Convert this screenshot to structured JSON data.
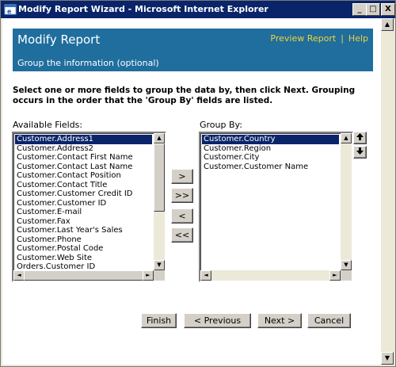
{
  "window": {
    "title": "Modify Report Wizard - Microsoft Internet Explorer",
    "minimize": "_",
    "maximize": "□",
    "close": "X"
  },
  "banner": {
    "title": "Modify Report",
    "subtitle": "Group the information (optional)",
    "preview_link": "Preview Report",
    "separator": "|",
    "help_link": "Help"
  },
  "instructions": "Select one or more fields to group the data by, then click Next. Grouping occurs in the order that the 'Group By' fields are listed.",
  "available": {
    "label": "Available Fields:",
    "items": [
      "Customer.Address1",
      "Customer.Address2",
      "Customer.Contact First Name",
      "Customer.Contact Last Name",
      "Customer.Contact Position",
      "Customer.Contact Title",
      "Customer.Customer Credit ID",
      "Customer.Customer ID",
      "Customer.E-mail",
      "Customer.Fax",
      "Customer.Last Year's Sales",
      "Customer.Phone",
      "Customer.Postal Code",
      "Customer.Web Site",
      "Orders.Customer ID"
    ],
    "selected_index": 0
  },
  "group_by": {
    "label": "Group By:",
    "items": [
      "Customer.Country",
      "Customer.Region",
      "Customer.City",
      "Customer.Customer Name"
    ],
    "selected_index": 0
  },
  "move_buttons": {
    "add": ">",
    "add_all": ">>",
    "remove": "<",
    "remove_all": "<<"
  },
  "footer": {
    "finish": "Finish",
    "previous": "< Previous",
    "next": "Next >",
    "cancel": "Cancel"
  }
}
